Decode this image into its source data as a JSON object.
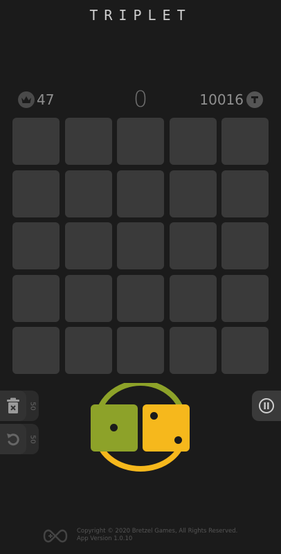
{
  "header": {
    "title": "TRIPLET"
  },
  "stats": {
    "best": "47",
    "score": "0",
    "tokens": "10016",
    "best_icon": "crown-icon",
    "token_icon": "token-t-icon"
  },
  "board": {
    "rows": 5,
    "cols": 5
  },
  "tools": {
    "trash": {
      "icon": "trash-icon",
      "cost": "50"
    },
    "undo": {
      "icon": "undo-icon",
      "cost": "50"
    },
    "pause": {
      "icon": "pause-icon"
    }
  },
  "dice": {
    "left": {
      "value": 1,
      "color": "#8da229"
    },
    "right": {
      "value": 2,
      "color": "#f6b81c"
    },
    "ring_colors": [
      "#8da229",
      "#f6b81c"
    ]
  },
  "footer": {
    "copyright": "Copyright © 2020 Bretzel Games, All Rights Reserved.",
    "version": "App Version 1.0.10",
    "logo_icon": "gamepad-logo-icon"
  }
}
